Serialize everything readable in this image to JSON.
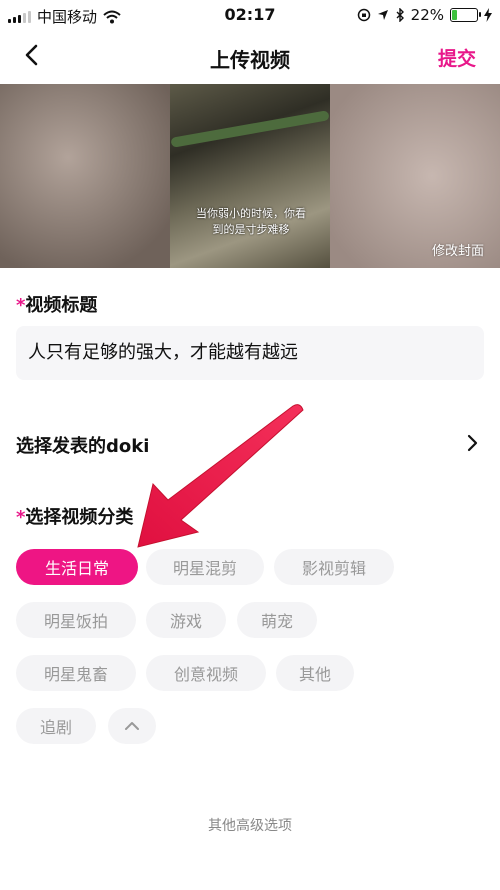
{
  "status_bar": {
    "carrier": "中国移动",
    "time": "02:17",
    "battery": "22%",
    "battery_level": 0.22
  },
  "nav": {
    "title": "上传视频",
    "submit_label": "提交"
  },
  "cover": {
    "subtitle_line1": "当你弱小的时候，你看",
    "subtitle_line2": "到的是寸步难移",
    "edit_label": "修改封面"
  },
  "title_section": {
    "required_mark": "*",
    "label": "视频标题",
    "value": "人只有足够的强大，才能越有越远"
  },
  "doki": {
    "label": "选择发表的doki"
  },
  "category": {
    "required_mark": "*",
    "label": "选择视频分类",
    "tags": [
      "生活日常",
      "明星混剪",
      "影视剪辑",
      "明星饭拍",
      "游戏",
      "萌宠",
      "明星鬼畜",
      "创意视频",
      "其他",
      "追剧"
    ],
    "selected": "生活日常"
  },
  "more_options": "其他高级选项",
  "colors": {
    "accent": "#e8188a",
    "tag_active": "#ee1584",
    "tag_bg": "#f4f4f6",
    "arrow": "#e8184a"
  }
}
